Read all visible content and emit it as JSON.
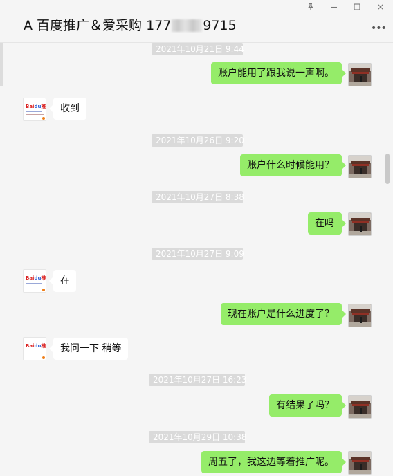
{
  "window": {
    "title_prefix": "A 百度推广＆爱采购 177",
    "title_suffix": "9715",
    "buttons": {
      "pin": "pin-icon",
      "minimize": "minimize-icon",
      "maximize": "maximize-icon",
      "close": "close-icon"
    },
    "more": "more-icon"
  },
  "messages": [
    {
      "type": "time",
      "text": "2021年10月21日 9:44"
    },
    {
      "type": "msg",
      "side": "right",
      "text": "账户能用了跟我说一声啊。"
    },
    {
      "type": "msg",
      "side": "left",
      "text": "收到"
    },
    {
      "type": "time",
      "text": "2021年10月26日 9:20"
    },
    {
      "type": "msg",
      "side": "right",
      "text": "账户什么时候能用？"
    },
    {
      "type": "time",
      "text": "2021年10月27日 8:38"
    },
    {
      "type": "msg",
      "side": "right",
      "text": "在吗"
    },
    {
      "type": "time",
      "text": "2021年10月27日 9:09"
    },
    {
      "type": "msg",
      "side": "left",
      "text": "在"
    },
    {
      "type": "msg",
      "side": "right",
      "text": "现在账户是什么进度了？"
    },
    {
      "type": "msg",
      "side": "left",
      "text": "我问一下 稍等"
    },
    {
      "type": "time",
      "text": "2021年10月27日 16:23"
    },
    {
      "type": "msg",
      "side": "right",
      "text": "有结果了吗？"
    },
    {
      "type": "time",
      "text": "2021年10月29日 10:38"
    },
    {
      "type": "msg",
      "side": "right",
      "text": "周五了，我这边等着推广呢。"
    }
  ],
  "avatar_left": {
    "logo_red": "Bai",
    "logo_blue": "du",
    "logo_tag": "推广"
  },
  "colors": {
    "background": "#f5f5f5",
    "bubble_right": "#95ec69",
    "bubble_left": "#ffffff",
    "timestamp_bg": "#dadada"
  }
}
